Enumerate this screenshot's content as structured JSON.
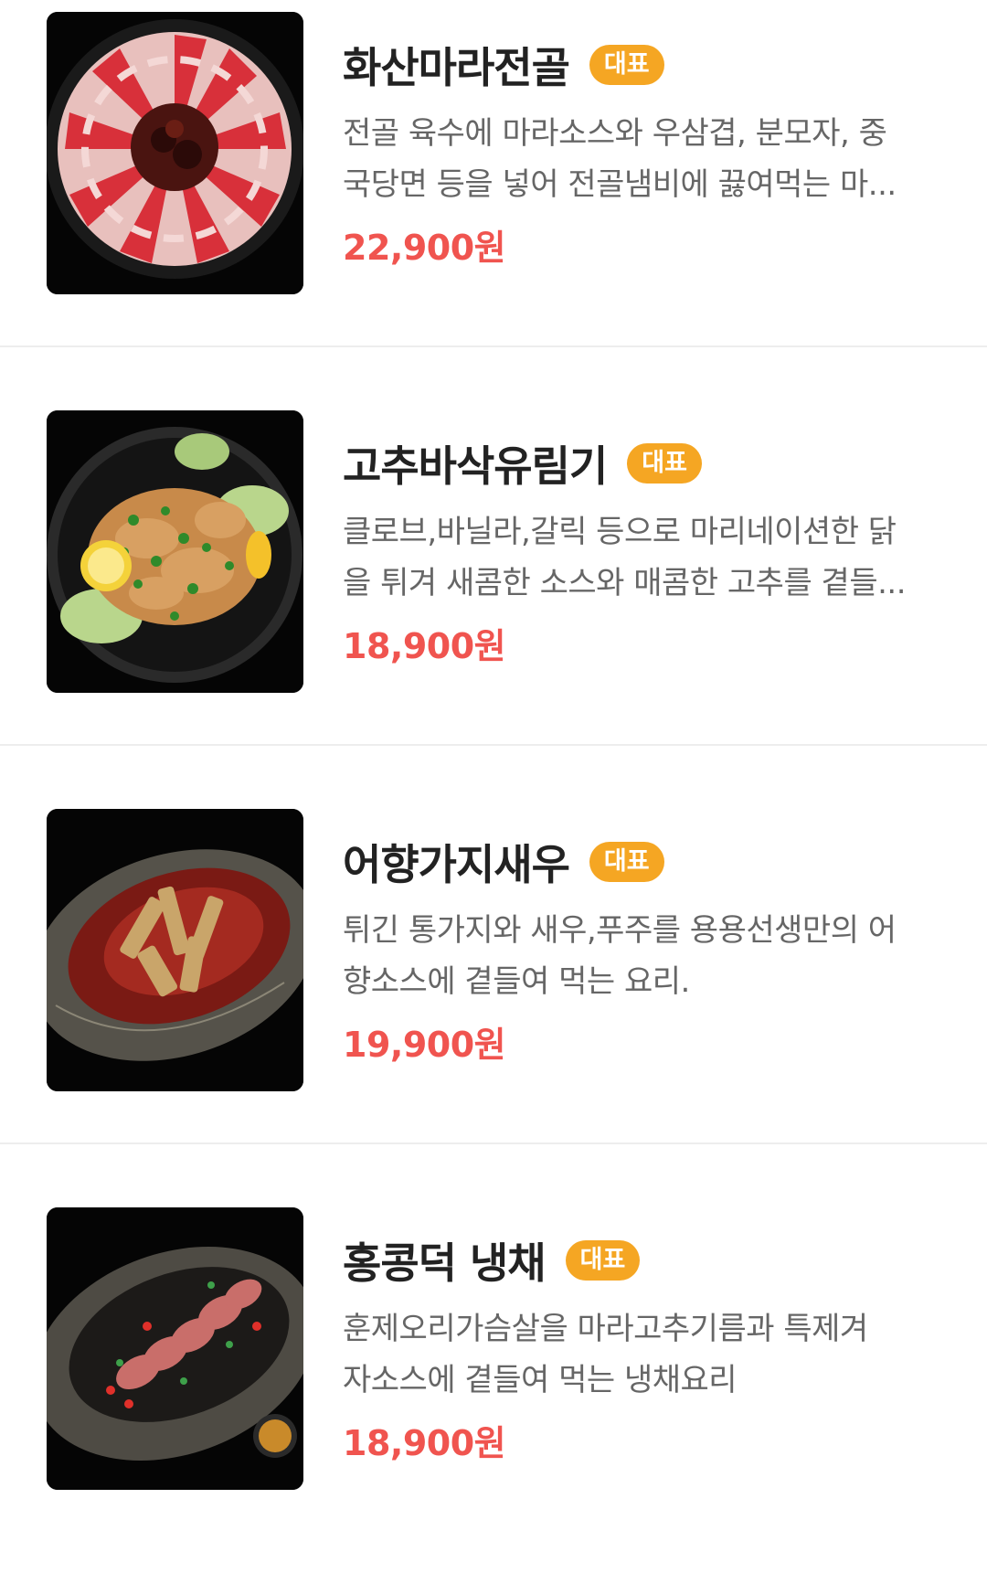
{
  "badge_label": "대표",
  "colors": {
    "price": "#f0544f",
    "badge": "#f5a623",
    "title": "#222222",
    "desc": "#666666"
  },
  "items": [
    {
      "name": "화산마라전골",
      "desc_line1": "전골 육수에 마라소스와 우삼겹, 분모자, 중",
      "desc_line2": "국당면 등을 넣어 전골냄비에 끓여먹는 마...",
      "price": "22,900원",
      "image_icon": "mala-hotpot-photo"
    },
    {
      "name": "고추바삭유림기",
      "desc_line1": "클로브,바닐라,갈릭 등으로 마리네이션한 닭",
      "desc_line2": "을 튀겨 새콤한 소스와 매콤한 고추를 곁들...",
      "price": "18,900원",
      "image_icon": "fried-chicken-photo"
    },
    {
      "name": "어향가지새우",
      "desc_line1": "튀긴 통가지와 새우,푸주를 용용선생만의 어",
      "desc_line2": "향소스에 곁들여 먹는 요리.",
      "price": "19,900원",
      "image_icon": "eggplant-shrimp-photo"
    },
    {
      "name": "홍콩덕 냉채",
      "desc_line1": "훈제오리가슴살을 마라고추기름과 특제겨",
      "desc_line2": "자소스에 곁들여 먹는 냉채요리",
      "price": "18,900원",
      "image_icon": "duck-salad-photo"
    }
  ]
}
